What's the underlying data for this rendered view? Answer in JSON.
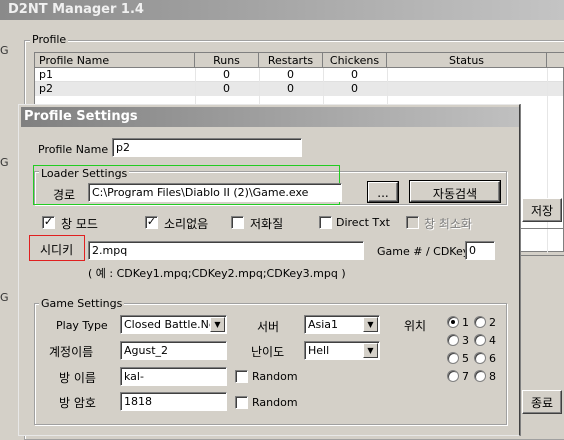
{
  "manager": {
    "title": "D2NT Manager 1.4",
    "profile_group": "Profile",
    "columns": [
      "Profile Name",
      "Runs",
      "Restarts",
      "Chickens",
      "Status"
    ],
    "rows": [
      {
        "name": "p1",
        "runs": "0",
        "restarts": "0",
        "chickens": "0",
        "status": ""
      },
      {
        "name": "p2",
        "runs": "0",
        "restarts": "0",
        "chickens": "0",
        "status": ""
      }
    ],
    "edge_letters": [
      "G",
      "G",
      "G"
    ],
    "save_label": "저장",
    "exit_label": "종료"
  },
  "dialog": {
    "title": "Profile Settings",
    "profile_name_label": "Profile Name",
    "profile_name_value": "p2",
    "loader": {
      "legend": "Loader Settings",
      "path_label": "경로",
      "path_value": "C:\\Program Files\\Diablo II (2)\\Game.exe",
      "browse_label": "...",
      "autosearch_label": "자동검색"
    },
    "options": {
      "window_mode": "창 모드",
      "no_sound": "소리없음",
      "low_quality": "저화질",
      "direct_txt": "Direct Txt",
      "minimize": "창 최소화"
    },
    "cdkey": {
      "label": "시디키",
      "value": "2.mpq",
      "hint": "( 예 : CDKey1.mpq;CDKey2.mpq;CDKey3.mpq )",
      "game_cdkey_label": "Game # / CDKey",
      "game_cdkey_value": "0"
    },
    "game": {
      "legend": "Game Settings",
      "play_type_label": "Play Type",
      "play_type_value": "Closed Battle.Net",
      "server_label": "서버",
      "server_value": "Asia1",
      "account_label": "계정이름",
      "account_value": "Agust_2",
      "difficulty_label": "난이도",
      "difficulty_value": "Hell",
      "room_name_label": "방 이름",
      "room_name_value": "kal-",
      "room_pw_label": "방 암호",
      "room_pw_value": "1818",
      "random_label": "Random",
      "position_label": "위치",
      "positions": [
        "1",
        "2",
        "3",
        "4",
        "5",
        "6",
        "7",
        "8"
      ]
    }
  },
  "colors": {
    "highlight_green": "#22cc22",
    "highlight_red": "#e02020"
  }
}
